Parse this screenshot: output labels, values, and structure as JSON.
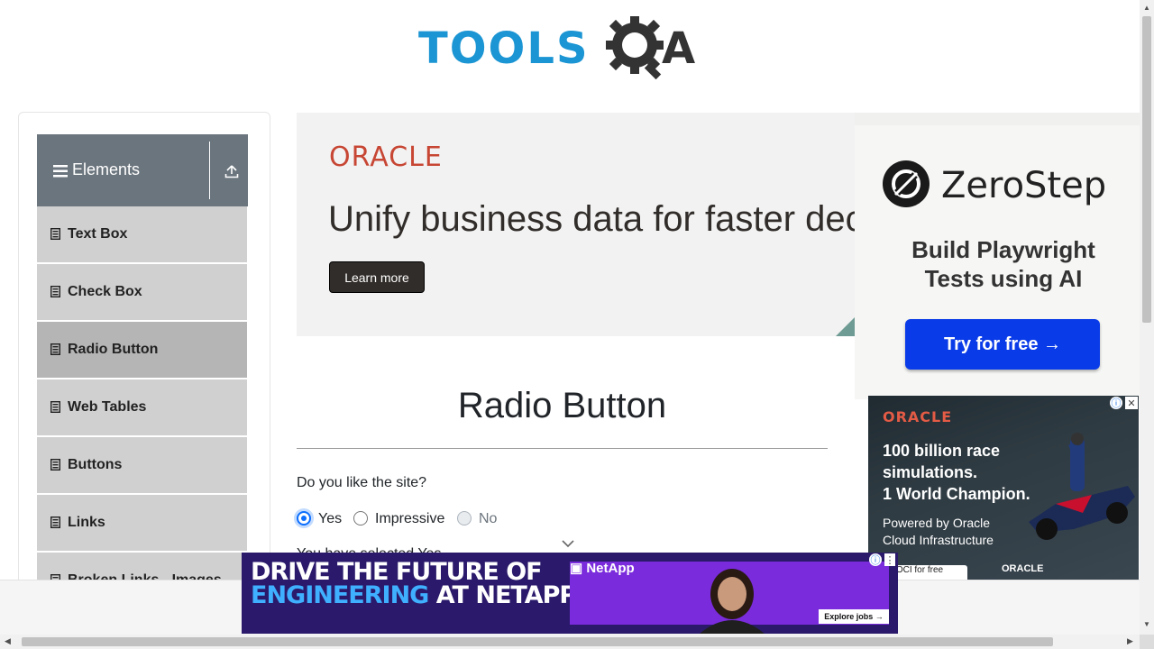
{
  "header": {
    "logo_left": "TOOLS",
    "logo_right": "A"
  },
  "sidebar": {
    "group_title": "Elements",
    "items": [
      {
        "label": "Text Box"
      },
      {
        "label": "Check Box"
      },
      {
        "label": "Radio Button",
        "active": true
      },
      {
        "label": "Web Tables"
      },
      {
        "label": "Buttons"
      },
      {
        "label": "Links"
      },
      {
        "label": "Broken Links - Images"
      }
    ]
  },
  "ads": {
    "oracle_banner": {
      "brand": "ORACLE",
      "headline": "Unify business data for faster decisions",
      "cta": "Learn more"
    },
    "zerostep": {
      "brand": "ZeroStep",
      "tagline_1": "Build Playwright",
      "tagline_2": "Tests using AI",
      "cta": "Try for free →"
    },
    "oracle_race": {
      "brand": "ORACLE",
      "line1": "100 billion race",
      "line2": "simulations.",
      "line3": "1 World Champion.",
      "powered_1": "Powered by Oracle",
      "powered_2": "Cloud Infrastructure",
      "button": "Try OCI for free",
      "footer_logo": "ORACLE",
      "info_glyph": "ⓘ",
      "close_glyph": "✕"
    },
    "netapp": {
      "line1": "DRIVE THE FUTURE OF",
      "line2_highlight": "ENGINEERING",
      "line2_rest": " AT NETAPP",
      "brand": "NetApp",
      "cta": "Explore jobs →",
      "info_glyph": "ⓘ",
      "more_glyph": "⋮"
    }
  },
  "main": {
    "title": "Radio Button",
    "question": "Do you like the site?",
    "options": [
      {
        "label": "Yes",
        "checked": true,
        "disabled": false
      },
      {
        "label": "Impressive",
        "checked": false,
        "disabled": false
      },
      {
        "label": "No",
        "checked": false,
        "disabled": true
      }
    ],
    "result_text": "You have selected Yes"
  },
  "colors": {
    "brand_blue": "#1b95d3",
    "sidebar_header": "#6b757d",
    "radio_accent": "#0d6efd",
    "oracle_red": "#c74634"
  }
}
